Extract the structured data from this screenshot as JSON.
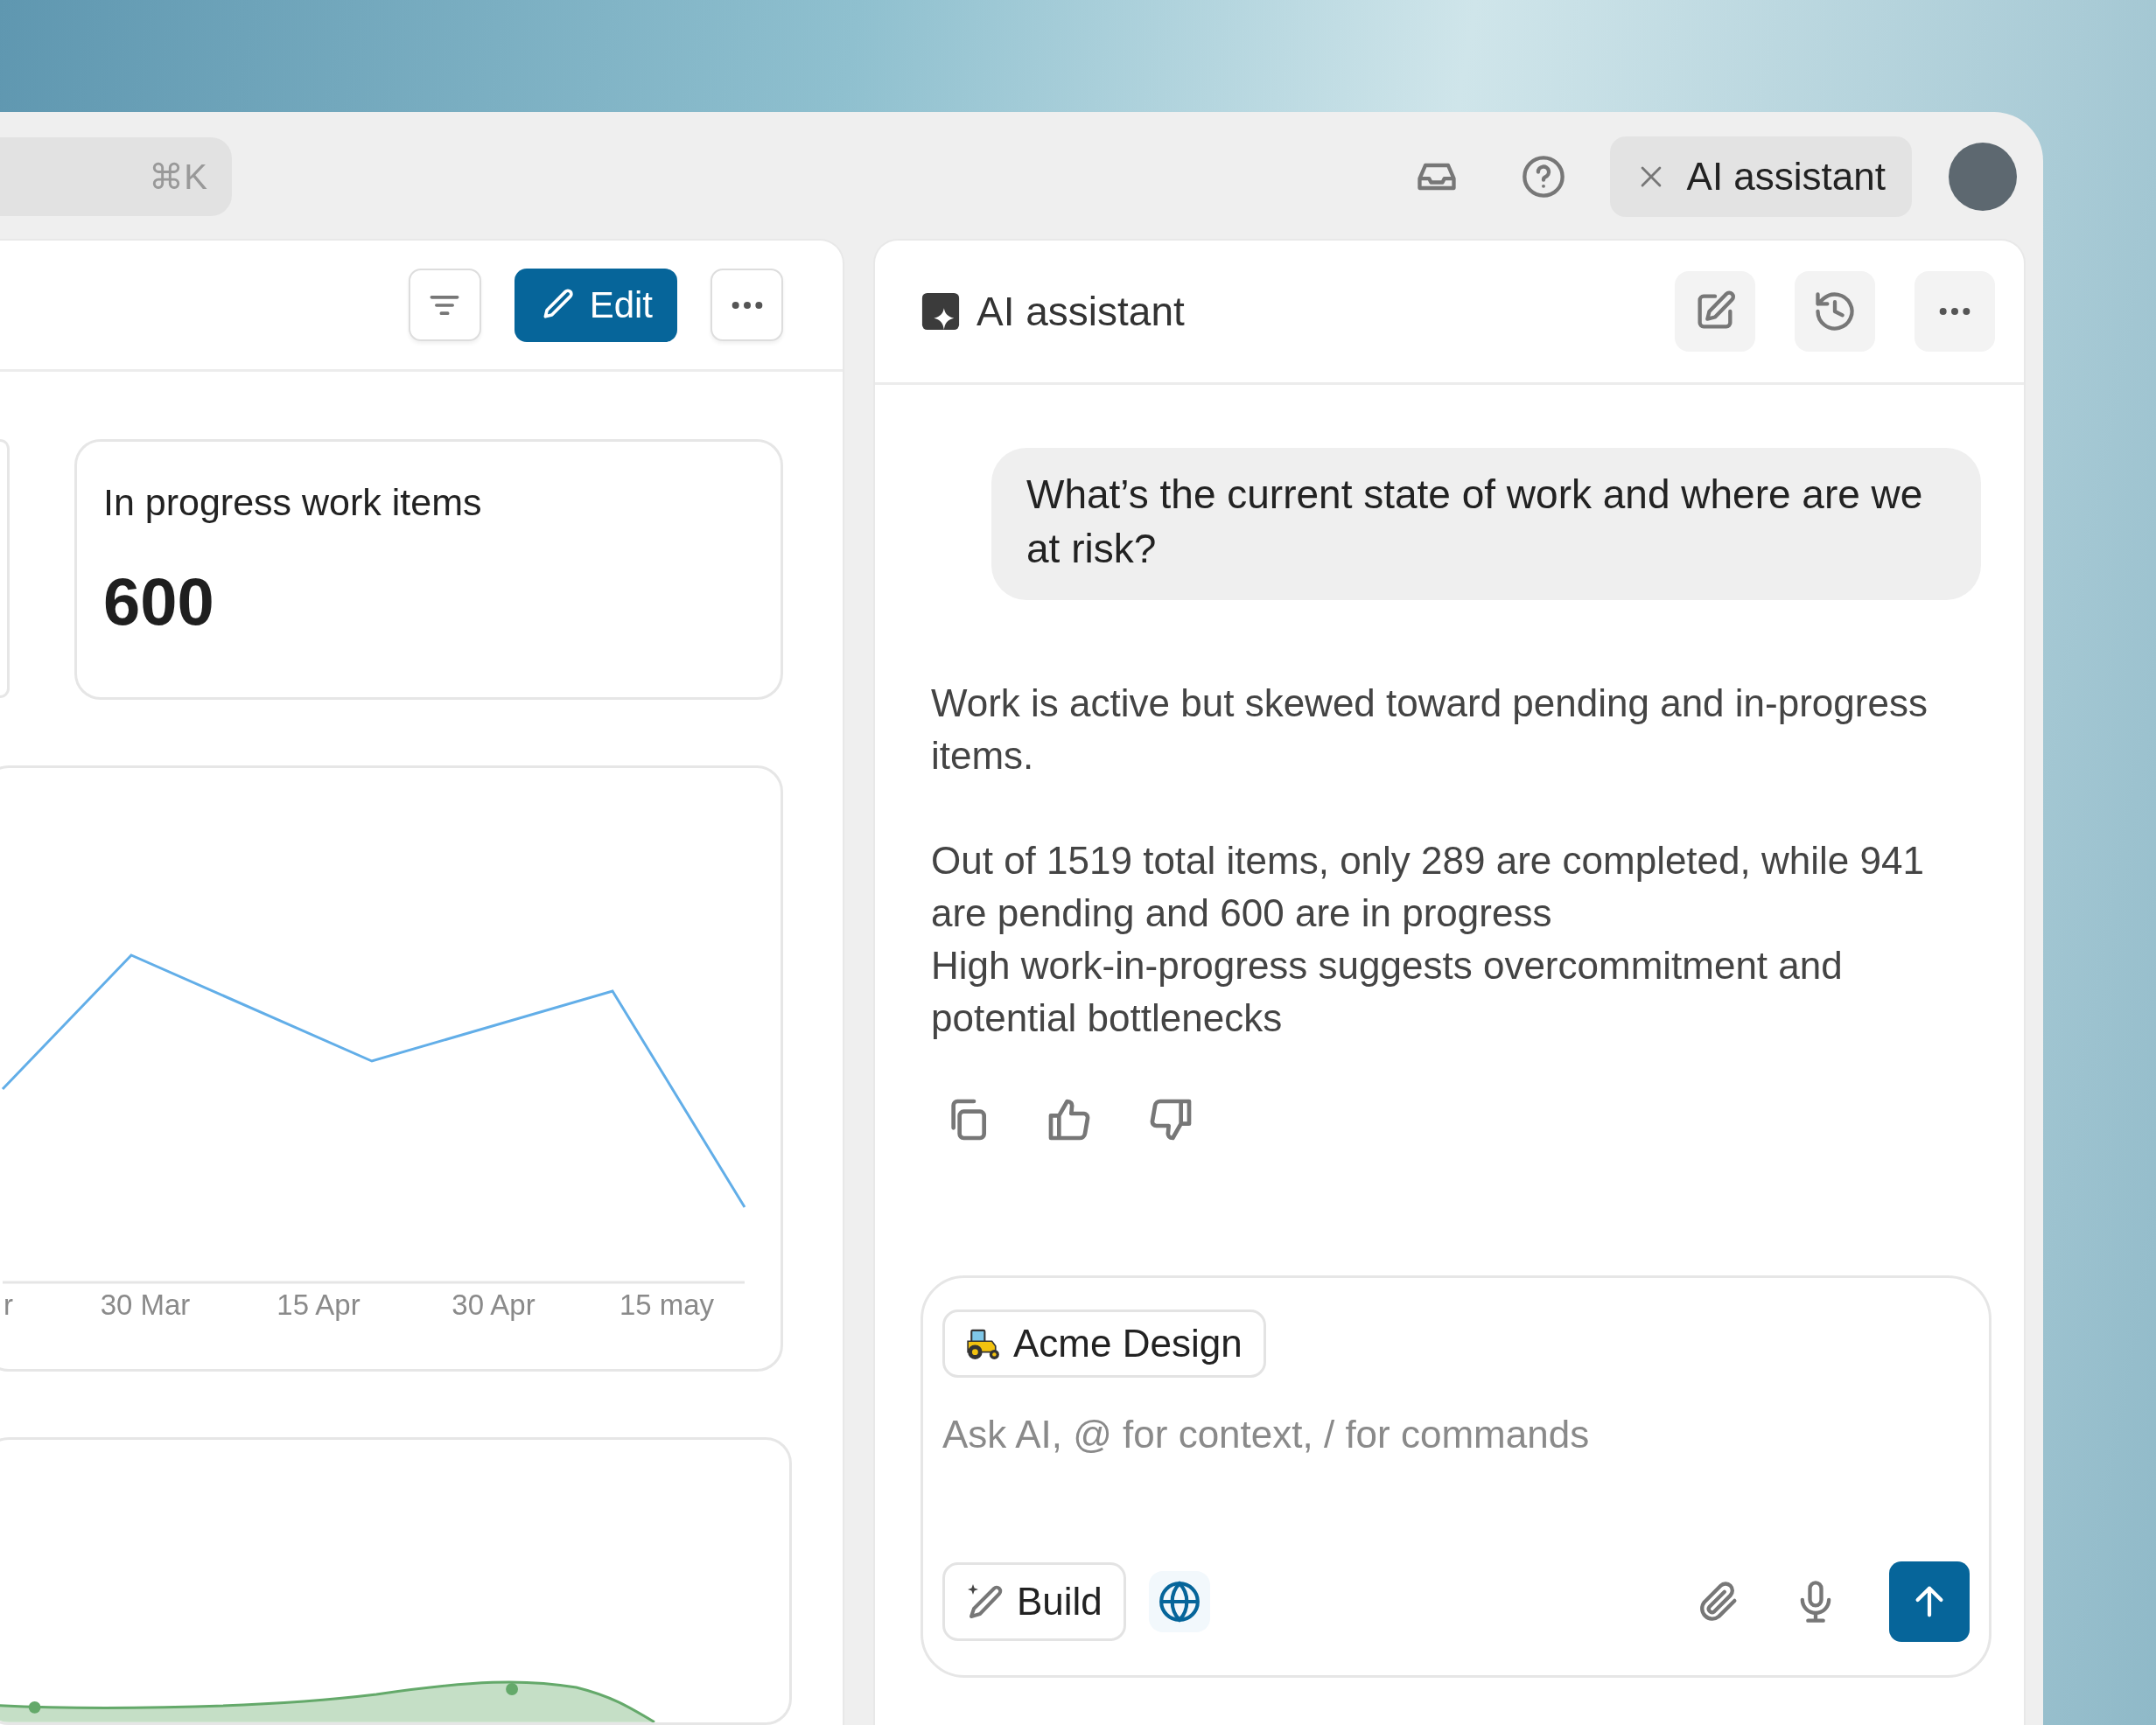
{
  "topbar": {
    "search_shortcut": "⌘K",
    "assistant_toggle": "AI assistant"
  },
  "dashboard": {
    "toolbar": {
      "edit_label": "Edit"
    },
    "metric_card": {
      "title": "In progress work items",
      "value": "600"
    },
    "line_chart": {
      "x_labels": [
        "r",
        "30 Mar",
        "15 Apr",
        "30 Apr",
        "15 may"
      ]
    }
  },
  "assistant": {
    "title": "AI assistant",
    "user_message": "What’s the current state of work and where are we at risk?",
    "response": [
      {
        "lines": [
          "Work is active but skewed toward pending and in-progress items."
        ]
      },
      {
        "lines": [
          "Out of 1519 total items, only 289 are completed, while 941 are pending and 600 are in progress",
          "High work-in-progress suggests overcommitment and potential bottlenecks"
        ]
      }
    ],
    "composer": {
      "context_chip": "Acme Design",
      "placeholder": "Ask AI, @ for context, / for commands",
      "build_label": "Build"
    }
  }
}
